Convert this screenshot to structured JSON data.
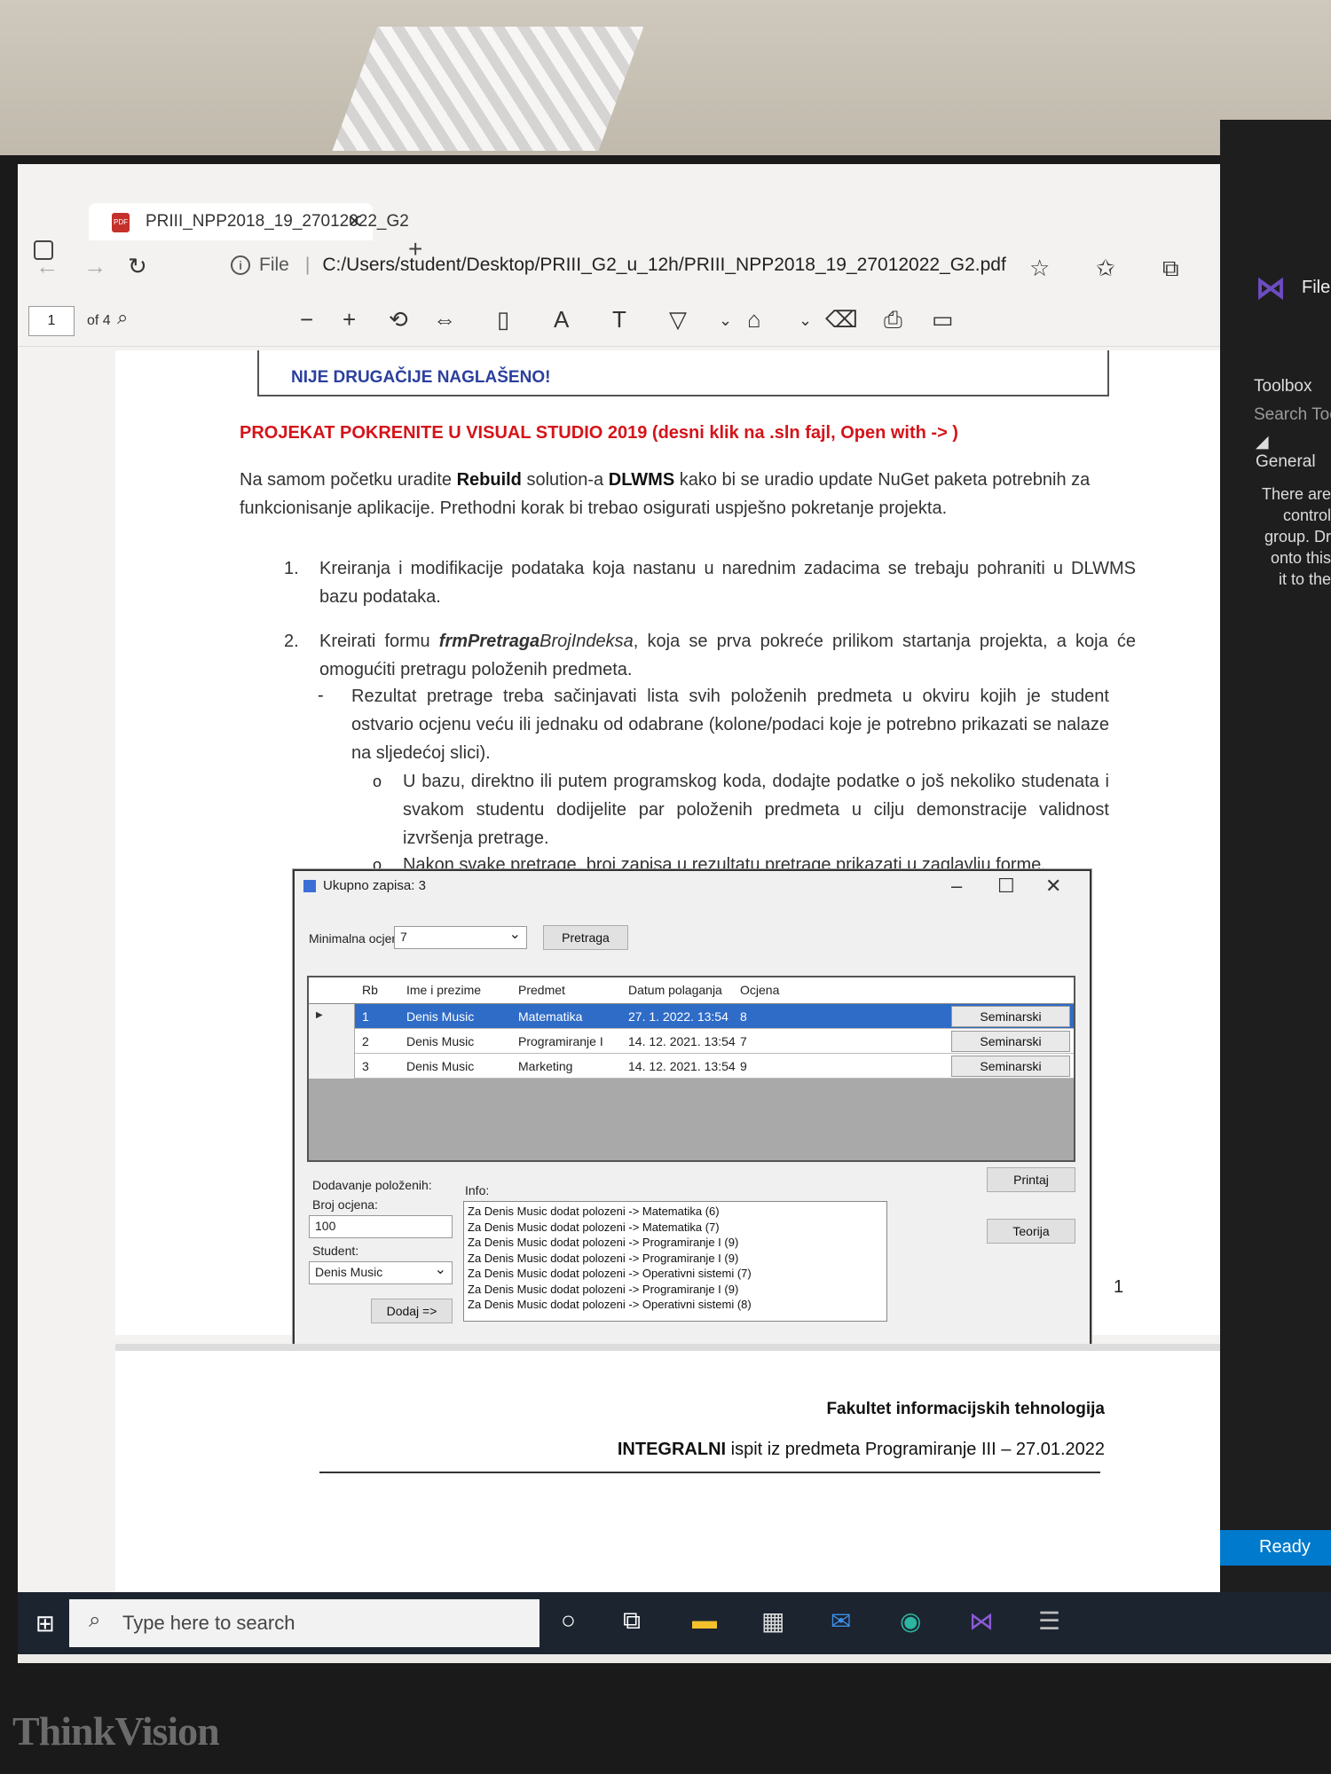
{
  "browser": {
    "tab_title": "PRIII_NPP2018_19_27012022_G2",
    "pdf_badge": "PDF",
    "tab_close": "✕",
    "new_tab": "+",
    "url_scheme": "File",
    "url": "C:/Users/student/Desktop/PRIII_G2_u_12h/PRIII_NPP2018_19_27012022_G2.pdf",
    "page_current": "1",
    "page_total": "of 4"
  },
  "doc": {
    "box_text": "NIJE DRUGAČIJE NAGLAŠENO!",
    "red_line": "PROJEKAT POKRENITE U VISUAL STUDIO 2019 (desni klik na .sln fajl, Open with -> )",
    "intro_a": "Na samom početku uradite ",
    "intro_b": "Rebuild",
    "intro_c": " solution-a ",
    "intro_d": "DLWMS",
    "intro_e": " kako bi se uradio update NuGet paketa potrebnih za funkcionisanje aplikacije. Prethodni korak bi trebao osigurati uspješno pokretanje projekta.",
    "item1_num": "1.",
    "item1": "Kreiranja i modifikacije podataka koja nastanu u narednim zadacima se trebaju pohraniti u DLWMS bazu podataka.",
    "item2_num": "2.",
    "item2_a": "Kreirati formu ",
    "item2_b": "frmPretraga",
    "item2_c": "BrojIndeksa",
    "item2_d": ", koja se prva pokreće prilikom startanja projekta, a koja će omogućiti pretragu položenih predmeta.",
    "dash_mark": "-",
    "sub1": "Rezultat pretrage treba sačinjavati lista svih položenih predmeta u okviru kojih je student ostvario ocjenu veću ili jednaku od odabrane (kolone/podaci koje je potrebno prikazati se nalaze na sljedećoj slici).",
    "bullet": "o",
    "subsub1": "U bazu, direktno ili putem programskog koda, dodajte podatke o još nekoliko studenata i svakom studentu dodijelite par položenih predmeta u cilju demonstracije validnost izvršenja pretrage.",
    "subsub2": "Nakon svake pretrage, broj zapisa u rezultatu pretrage prikazati u zaglavlju forme.",
    "page_number": "1",
    "faculty": "Fakultet informacijskih tehnologija",
    "exam_a": "INTEGRALNI",
    "exam_b": " ispit iz predmeta Programiranje III – 27.01.2022"
  },
  "form": {
    "title": "Ukupno zapisa: 3",
    "min_label": "Minimalna ocjena:",
    "min_value": "7",
    "search_btn": "Pretraga",
    "columns": [
      "Rb",
      "Ime i prezime",
      "Predmet",
      "Datum polaganja",
      "Ocjena"
    ],
    "rows": [
      {
        "rb": "1",
        "name": "Denis Music",
        "subject": "Matematika",
        "date": "27. 1. 2022. 13:54",
        "grade": "8",
        "btn": "Seminarski"
      },
      {
        "rb": "2",
        "name": "Denis Music",
        "subject": "Programiranje I",
        "date": "14. 12. 2021. 13:54",
        "grade": "7",
        "btn": "Seminarski"
      },
      {
        "rb": "3",
        "name": "Denis Music",
        "subject": "Marketing",
        "date": "14. 12. 2021. 13:54",
        "grade": "9",
        "btn": "Seminarski"
      }
    ],
    "add_label": "Dodavanje položenih:",
    "count_label": "Broj ocjena:",
    "count_value": "100",
    "student_label": "Student:",
    "student_value": "Denis Music",
    "add_btn": "Dodaj =>",
    "info_label": "Info:",
    "info_lines": [
      "Za Denis Music dodat polozeni -> Matematika (6)",
      "Za Denis Music dodat polozeni -> Matematika (7)",
      "Za Denis Music dodat polozeni -> Programiranje I (9)",
      "Za Denis Music dodat polozeni -> Programiranje I (9)",
      "Za Denis Music dodat polozeni -> Operativni sistemi (7)",
      "Za Denis Music dodat polozeni -> Programiranje I (9)",
      "Za Denis Music dodat polozeni -> Operativni sistemi (8)"
    ],
    "print_btn": "Printaj",
    "theory_btn": "Teorija"
  },
  "vs": {
    "file_menu": "File",
    "toolbox": "Toolbox",
    "search": "Search Tool",
    "general": "◢ General",
    "hint_lines": [
      "There are",
      "control",
      "group. Dr",
      "onto this",
      "it to the"
    ],
    "status": "Ready"
  },
  "taskbar": {
    "search_placeholder": "Type here to search"
  },
  "monitor_brand": "ThinkVision"
}
